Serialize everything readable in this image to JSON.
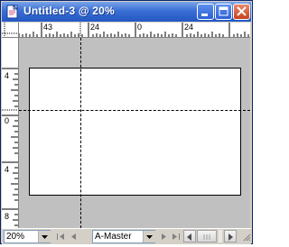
{
  "window": {
    "title": "Untitled-3 @ 20%"
  },
  "rulers": {
    "top_labels": [
      "43",
      "24",
      "0",
      "24"
    ],
    "left_labels": [
      "4",
      "0",
      "4",
      "8"
    ]
  },
  "statusbar": {
    "zoom_value": "20%",
    "page_value": "A-Master"
  },
  "icons": {
    "app": "document-icon",
    "minimize": "minimize-icon",
    "maximize": "maximize-icon",
    "close": "close-icon"
  },
  "colors": {
    "titlebar": "#2457c3",
    "pasteboard": "#c0c0c0",
    "page": "#ffffff",
    "close_button": "#c5411b"
  }
}
